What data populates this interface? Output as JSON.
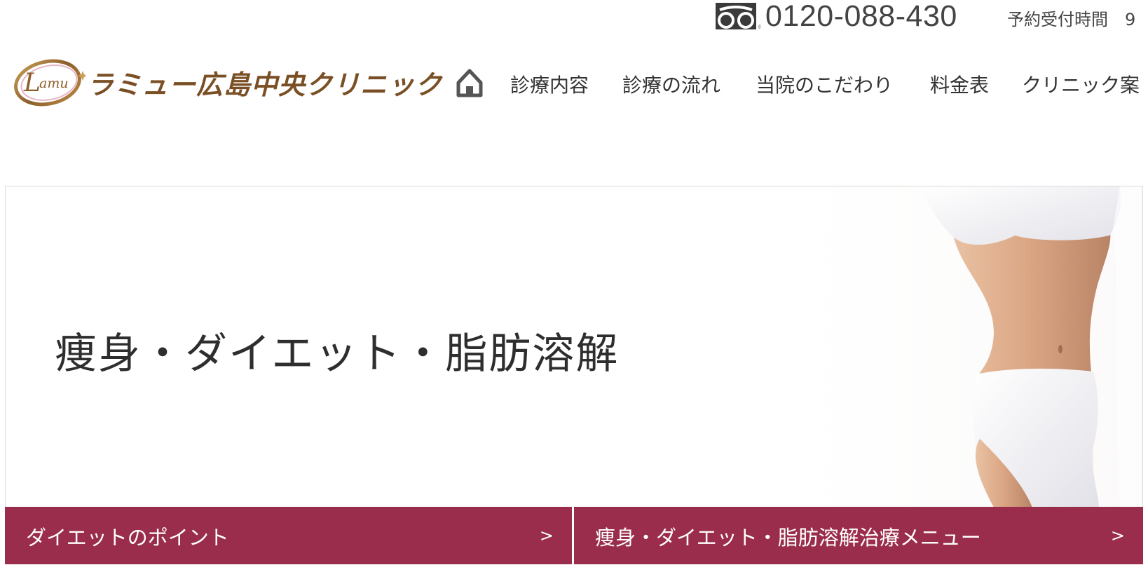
{
  "topbar": {
    "freedial_icon": "freedial-icon",
    "phone": "0120-088-430",
    "hours": "予約受付時間　9"
  },
  "header": {
    "logo_emblem_text": "Lamu",
    "logo_text": "ラミュー広島中央クリニック",
    "brand_color": "#7a4f25"
  },
  "nav": {
    "home_icon": "home-icon",
    "items": [
      {
        "label": "診療内容"
      },
      {
        "label": "診療の流れ"
      },
      {
        "label": "当院のこだわり"
      },
      {
        "label": "料金表"
      },
      {
        "label": "クリニック案"
      }
    ]
  },
  "hero": {
    "title": "痩身・ダイエット・脂肪溶解"
  },
  "buttons": {
    "accent": "#9a2d4b",
    "left": {
      "label": "ダイエットのポイント",
      "arrow": ">"
    },
    "right": {
      "label": "痩身・ダイエット・脂肪溶解治療メニュー",
      "arrow": ">"
    }
  }
}
